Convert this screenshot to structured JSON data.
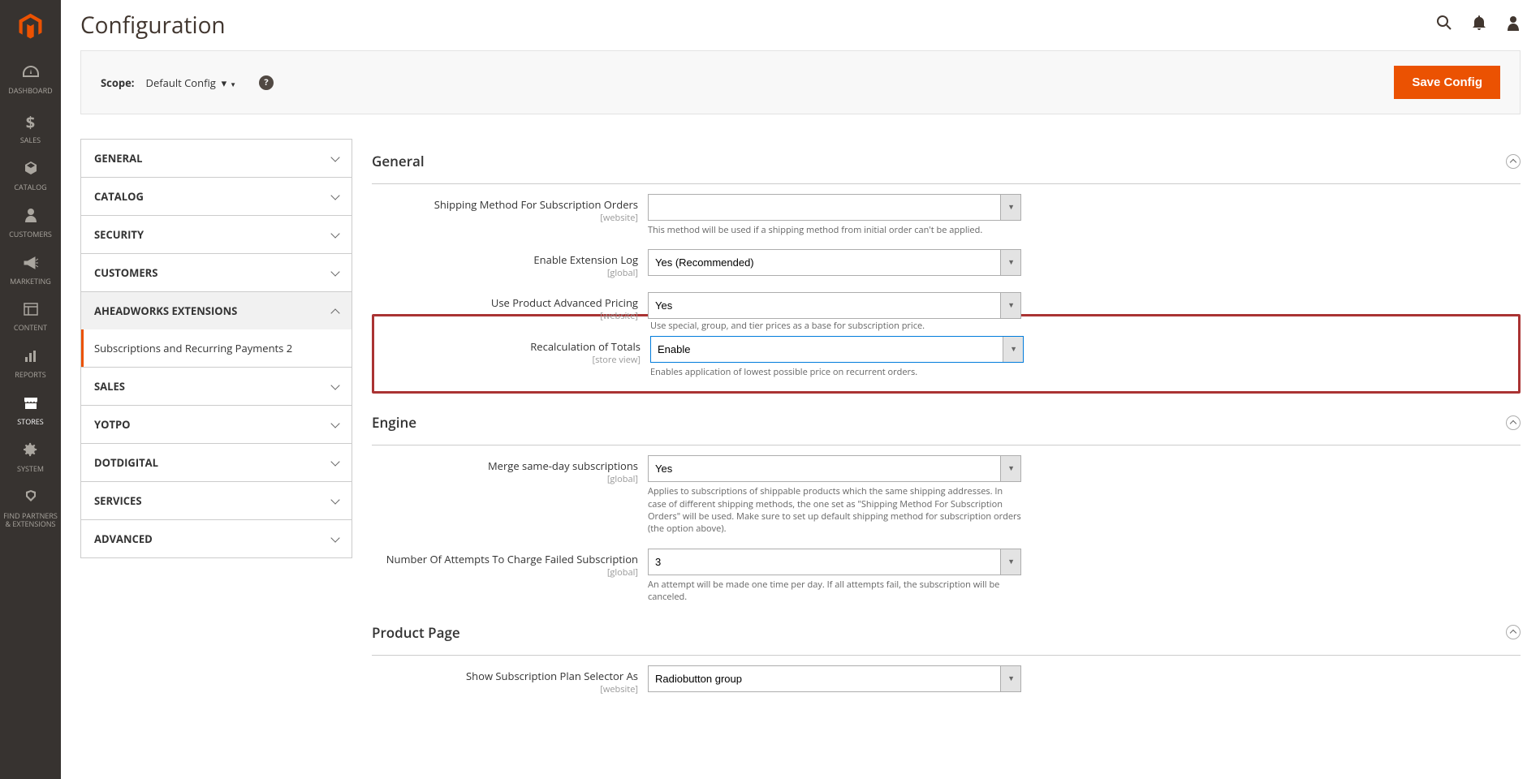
{
  "page_title": "Configuration",
  "scope": {
    "label": "Scope:",
    "value": "Default Config"
  },
  "save_button": "Save Config",
  "sidebar": {
    "items": [
      {
        "key": "dashboard",
        "label": "DASHBOARD",
        "icon": "◉"
      },
      {
        "key": "sales",
        "label": "SALES",
        "icon": "$"
      },
      {
        "key": "catalog",
        "label": "CATALOG",
        "icon": "◆"
      },
      {
        "key": "customers",
        "label": "CUSTOMERS",
        "icon": "👤"
      },
      {
        "key": "marketing",
        "label": "MARKETING",
        "icon": "📣"
      },
      {
        "key": "content",
        "label": "CONTENT",
        "icon": "▦"
      },
      {
        "key": "reports",
        "label": "REPORTS",
        "icon": "📊"
      },
      {
        "key": "stores",
        "label": "STORES",
        "icon": "🏬"
      },
      {
        "key": "system",
        "label": "SYSTEM",
        "icon": "⚙"
      },
      {
        "key": "findpartners",
        "label": "FIND PARTNERS & EXTENSIONS",
        "icon": "◈"
      }
    ]
  },
  "nav_sections": [
    {
      "label": "GENERAL",
      "expanded": false
    },
    {
      "label": "CATALOG",
      "expanded": false
    },
    {
      "label": "SECURITY",
      "expanded": false
    },
    {
      "label": "CUSTOMERS",
      "expanded": false
    },
    {
      "label": "AHEADWORKS EXTENSIONS",
      "expanded": true,
      "sub": "Subscriptions and Recurring Payments 2"
    },
    {
      "label": "SALES",
      "expanded": false
    },
    {
      "label": "YOTPO",
      "expanded": false
    },
    {
      "label": "DOTDIGITAL",
      "expanded": false
    },
    {
      "label": "SERVICES",
      "expanded": false
    },
    {
      "label": "ADVANCED",
      "expanded": false
    }
  ],
  "sections": {
    "general": {
      "title": "General",
      "fields": {
        "shipping": {
          "label": "Shipping Method For Subscription Orders",
          "scope": "[website]",
          "value": "",
          "note": "This method will be used if a shipping method from initial order can't be applied."
        },
        "log": {
          "label": "Enable Extension Log",
          "scope": "[global]",
          "value": "Yes (Recommended)"
        },
        "advpricing": {
          "label": "Use Product Advanced Pricing",
          "scope": "[website]",
          "value": "Yes",
          "note": "Use special, group, and tier prices as a base for subscription price."
        },
        "recalc": {
          "label": "Recalculation of Totals",
          "scope": "[store view]",
          "value": "Enable",
          "note": "Enables application of lowest possible price on recurrent orders."
        }
      }
    },
    "engine": {
      "title": "Engine",
      "fields": {
        "merge": {
          "label": "Merge same-day subscriptions",
          "scope": "[global]",
          "value": "Yes",
          "note": "Applies to subscriptions of shippable products which the same shipping addresses. In case of different shipping methods, the one set as \"Shipping Method For Subscription Orders\" will be used. Make sure to set up default shipping method for subscription orders (the option above)."
        },
        "attempts": {
          "label": "Number Of Attempts To Charge Failed Subscription",
          "scope": "[global]",
          "value": "3",
          "note": "An attempt will be made one time per day. If all attempts fail, the subscription will be canceled."
        }
      }
    },
    "productpage": {
      "title": "Product Page",
      "fields": {
        "selector": {
          "label": "Show Subscription Plan Selector As",
          "scope": "[website]",
          "value": "Radiobutton group"
        }
      }
    }
  }
}
